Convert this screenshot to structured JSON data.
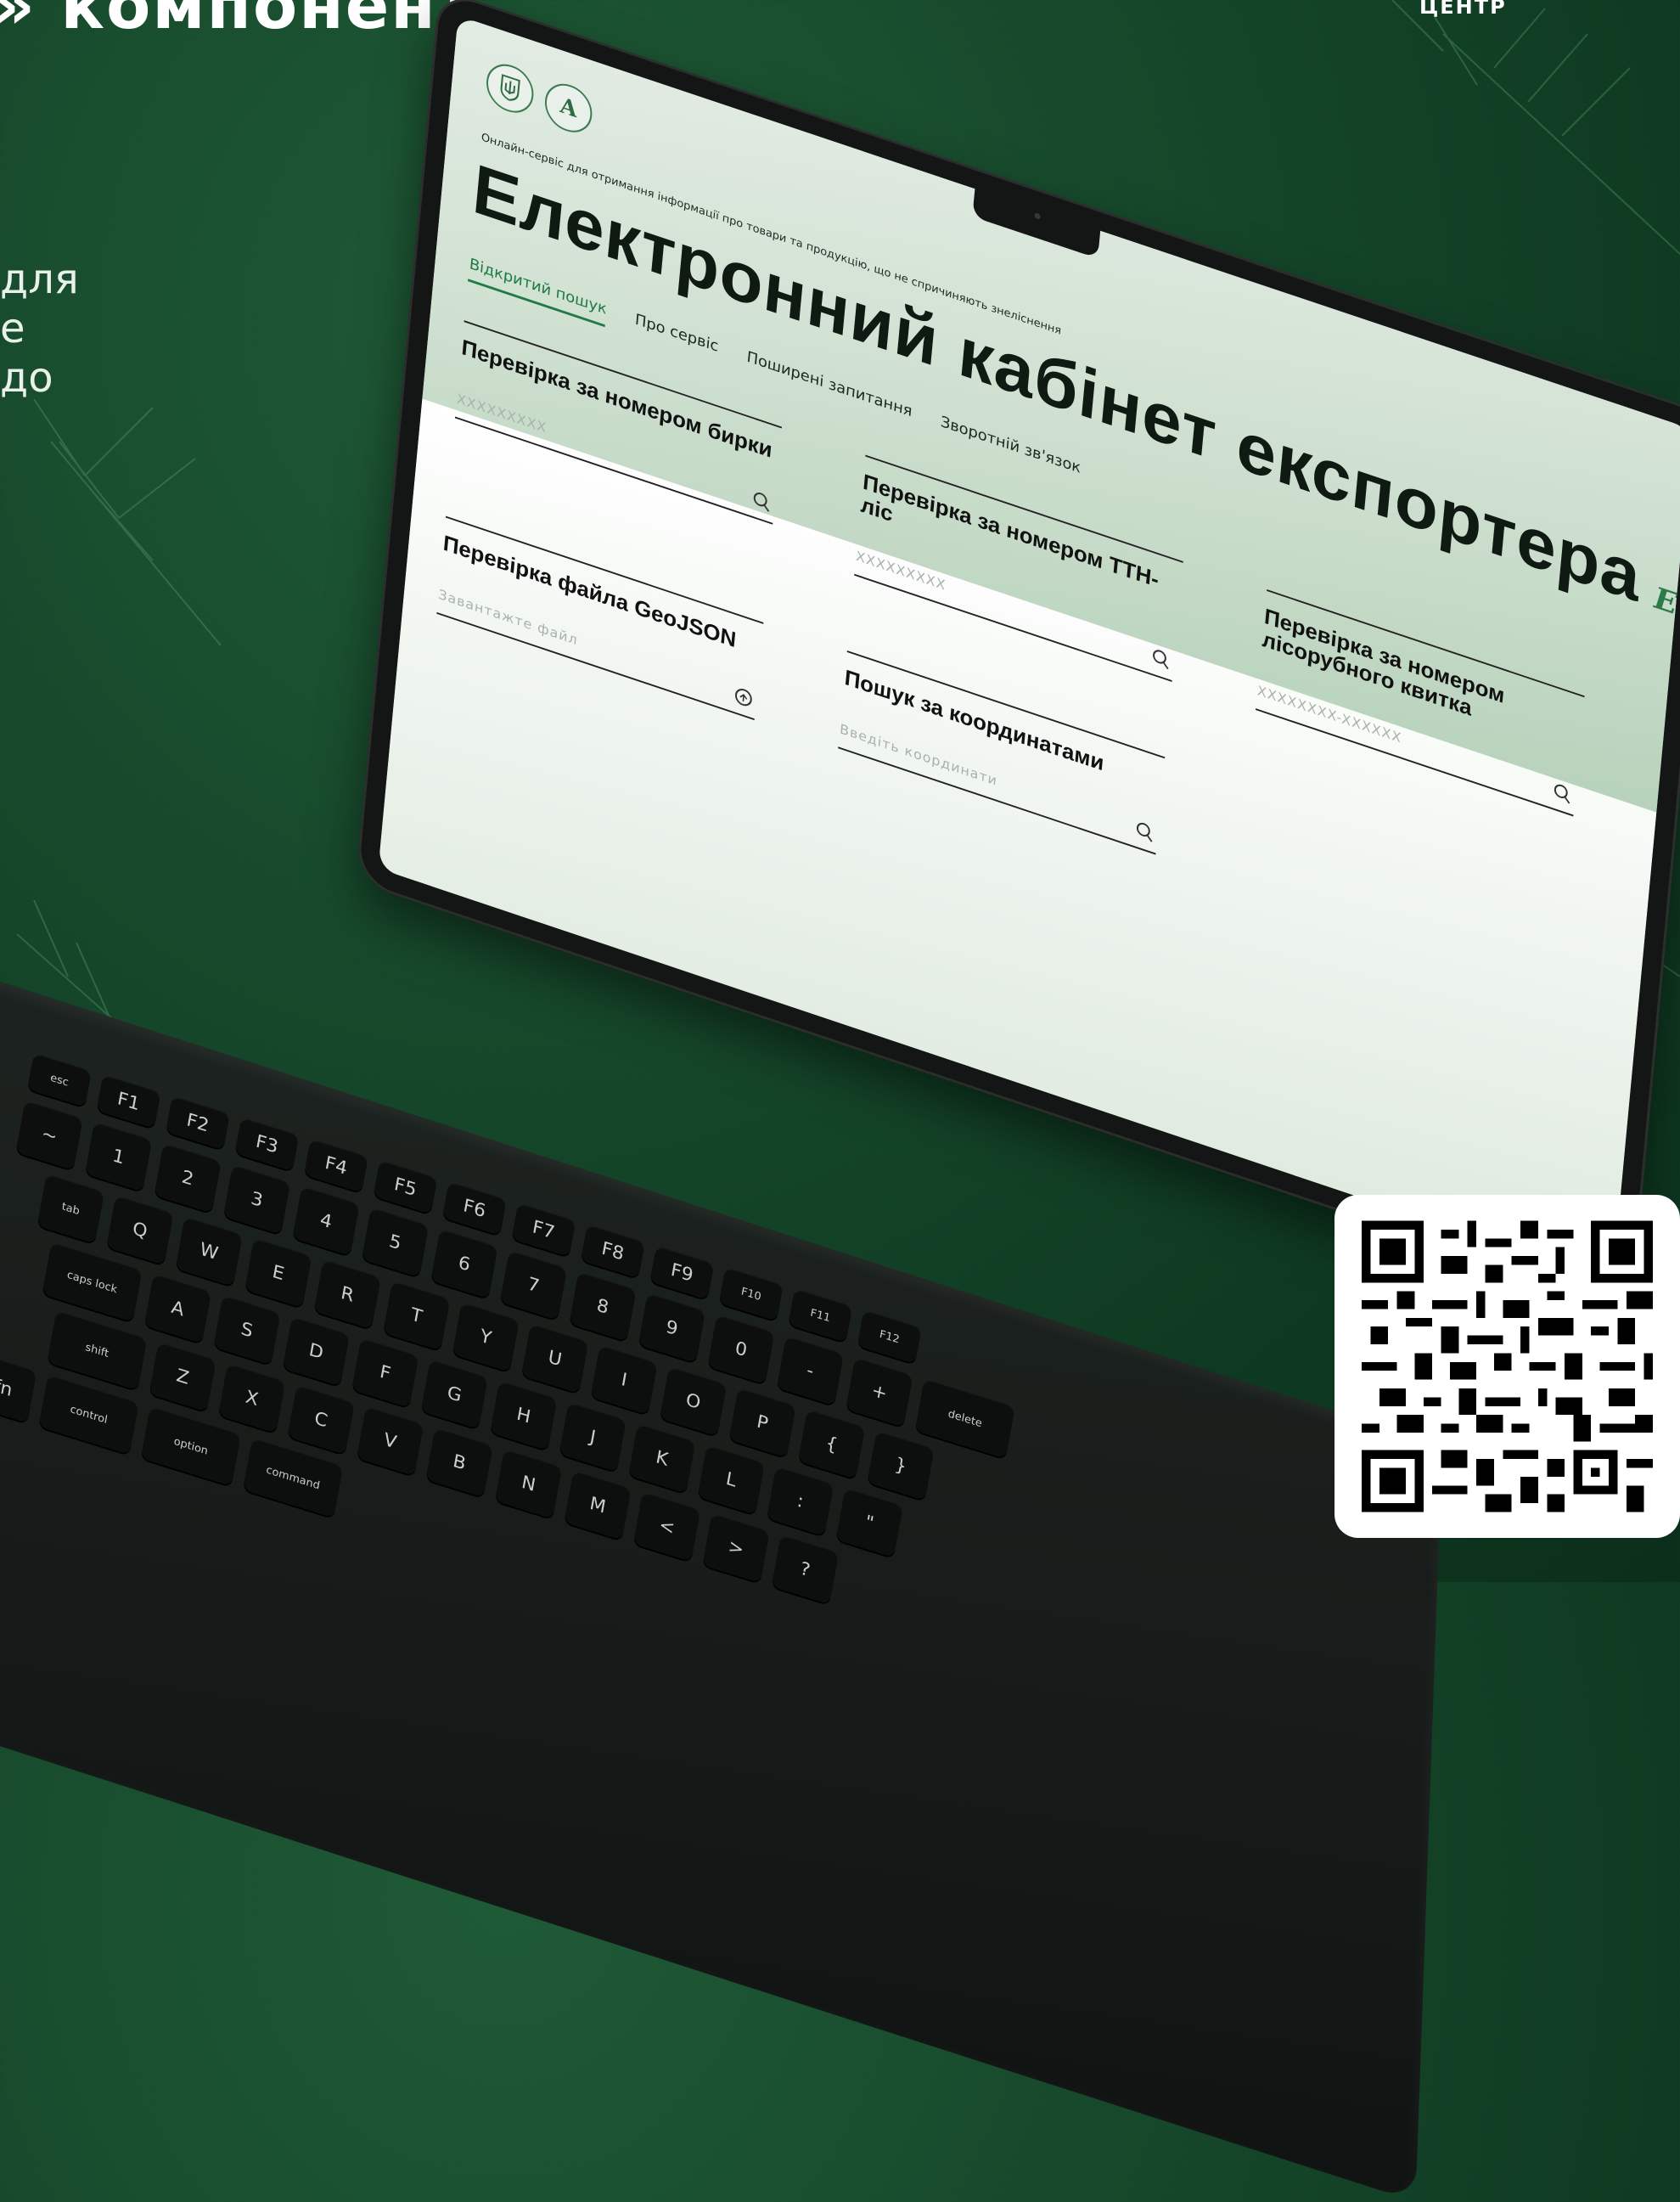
{
  "background": {
    "heading_fragment": "» компонент",
    "text_fragments": [
      "для",
      "е",
      "до"
    ],
    "corner_text": "ЦЕНТР"
  },
  "colors": {
    "background": "#174a2c",
    "accent": "#1f7a44",
    "title": "#0f1a13"
  },
  "site": {
    "logos": [
      "coat-of-arms-icon",
      "letter-a-logo-icon"
    ],
    "subtitle": "Онлайн-сервіс для отримання інформації про товари та продукцію, що не спричиняють знеліснення",
    "title": "Електронний кабінет експортера",
    "title_badge": "EUDR",
    "tabs": [
      {
        "label": "Відкритий пошук",
        "active": true
      },
      {
        "label": "Про сервіс",
        "active": false
      },
      {
        "label": "Поширені запитання",
        "active": false
      },
      {
        "label": "Зворотній зв'язок",
        "active": false
      }
    ],
    "cards": [
      {
        "title": "Перевірка за номером бирки",
        "placeholder": "XXXXXXXXX",
        "icon": "search-icon"
      },
      {
        "title": "Перевірка за номером ТТН-ліс",
        "placeholder": "XXXXXXXXX",
        "icon": "search-icon"
      },
      {
        "title": "Перевірка за номером лісорубного квитка",
        "placeholder": "XXXXXXXX-XXXXXX",
        "icon": "search-icon"
      },
      {
        "title": "Перевірка файла GeoJSON",
        "placeholder": "Завантажте файл",
        "icon": "upload-icon"
      },
      {
        "title": "Пошук за координатами",
        "placeholder": "Введіть координати",
        "icon": "search-icon"
      }
    ]
  },
  "keyboard": {
    "fn_row": [
      "esc",
      "F1",
      "F2",
      "F3",
      "F4",
      "F5",
      "F6",
      "F7",
      "F8",
      "F9",
      "F10",
      "F11",
      "F12"
    ],
    "num_row": [
      "~",
      "1",
      "2",
      "3",
      "4",
      "5",
      "6",
      "7",
      "8",
      "9",
      "0",
      "-",
      "+",
      "delete"
    ],
    "q_row": [
      "tab",
      "Q",
      "W",
      "E",
      "R",
      "T",
      "Y",
      "U",
      "I",
      "O",
      "P",
      "{",
      "}"
    ],
    "a_row": [
      "caps lock",
      "A",
      "S",
      "D",
      "F",
      "G",
      "H",
      "J",
      "K",
      "L",
      ":",
      "\""
    ],
    "z_row": [
      "shift",
      "Z",
      "X",
      "C",
      "V",
      "B",
      "N",
      "M",
      "<",
      ">",
      "?"
    ],
    "mod_row": [
      "fn",
      "control",
      "option",
      "command"
    ]
  },
  "qr": {
    "label": "qr-code"
  }
}
